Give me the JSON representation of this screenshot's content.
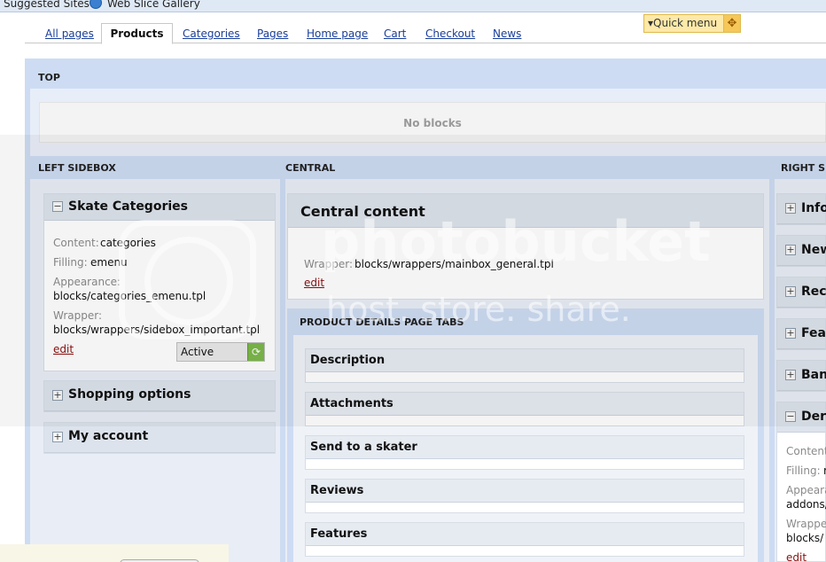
{
  "favorites": {
    "suggested": "Suggested Sites",
    "webslice": "Web Slice Gallery"
  },
  "tabs": {
    "all_pages": "All pages",
    "products": "Products",
    "categories": "Categories",
    "pages": "Pages",
    "home_page": "Home page",
    "cart": "Cart",
    "checkout": "Checkout",
    "news": "News"
  },
  "quick_menu": {
    "label": "Quick menu",
    "arrow": "▾",
    "move": "✥"
  },
  "groups": {
    "top": "TOP",
    "top_empty": "No blocks",
    "left": "LEFT SIDEBOX",
    "central": "CENTRAL",
    "right": "RIGHT SI"
  },
  "left_blocks": {
    "skate": {
      "title": "Skate Categories",
      "toggle": "−",
      "content_label": "Content:",
      "content_value": "categories",
      "filling_label": "Filling:",
      "filling_value": "emenu",
      "appearance_label": "Appearance:",
      "appearance_value": "blocks/categories_emenu.tpl",
      "wrapper_label": "Wrapper:",
      "wrapper_value": "blocks/wrappers/sidebox_important.tpl",
      "edit": "edit",
      "status": "Active",
      "status_icon": "⟳"
    },
    "shopping": {
      "title": "Shopping options",
      "toggle": "+"
    },
    "account": {
      "title": "My account",
      "toggle": "+"
    }
  },
  "central_block": {
    "title": "Central content",
    "wrapper_label": "Wrapper:",
    "wrapper_value": "blocks/wrappers/mainbox_general.tpl",
    "edit": "edit"
  },
  "product_tabs": {
    "heading": "PRODUCT DETAILS PAGE TABS",
    "items": [
      "Description",
      "Attachments",
      "Send to a skater",
      "Reviews",
      "Features"
    ]
  },
  "right_blocks": {
    "items": [
      "Info",
      "New",
      "Rece",
      "Feat",
      "Ban",
      "Derl"
    ],
    "toggles": [
      "+",
      "+",
      "+",
      "+",
      "+",
      "−"
    ],
    "props": {
      "content_label": "Content",
      "filling_label": "Filling:",
      "filling_value": "r",
      "appearance_label": "Appeara",
      "appearance_value": "addons/",
      "wrapper_label": "Wrappe",
      "wrapper_value": "blocks/",
      "edit": "edit"
    }
  },
  "watermark": {
    "line1": "photobucket",
    "line2": "host. store. share."
  }
}
